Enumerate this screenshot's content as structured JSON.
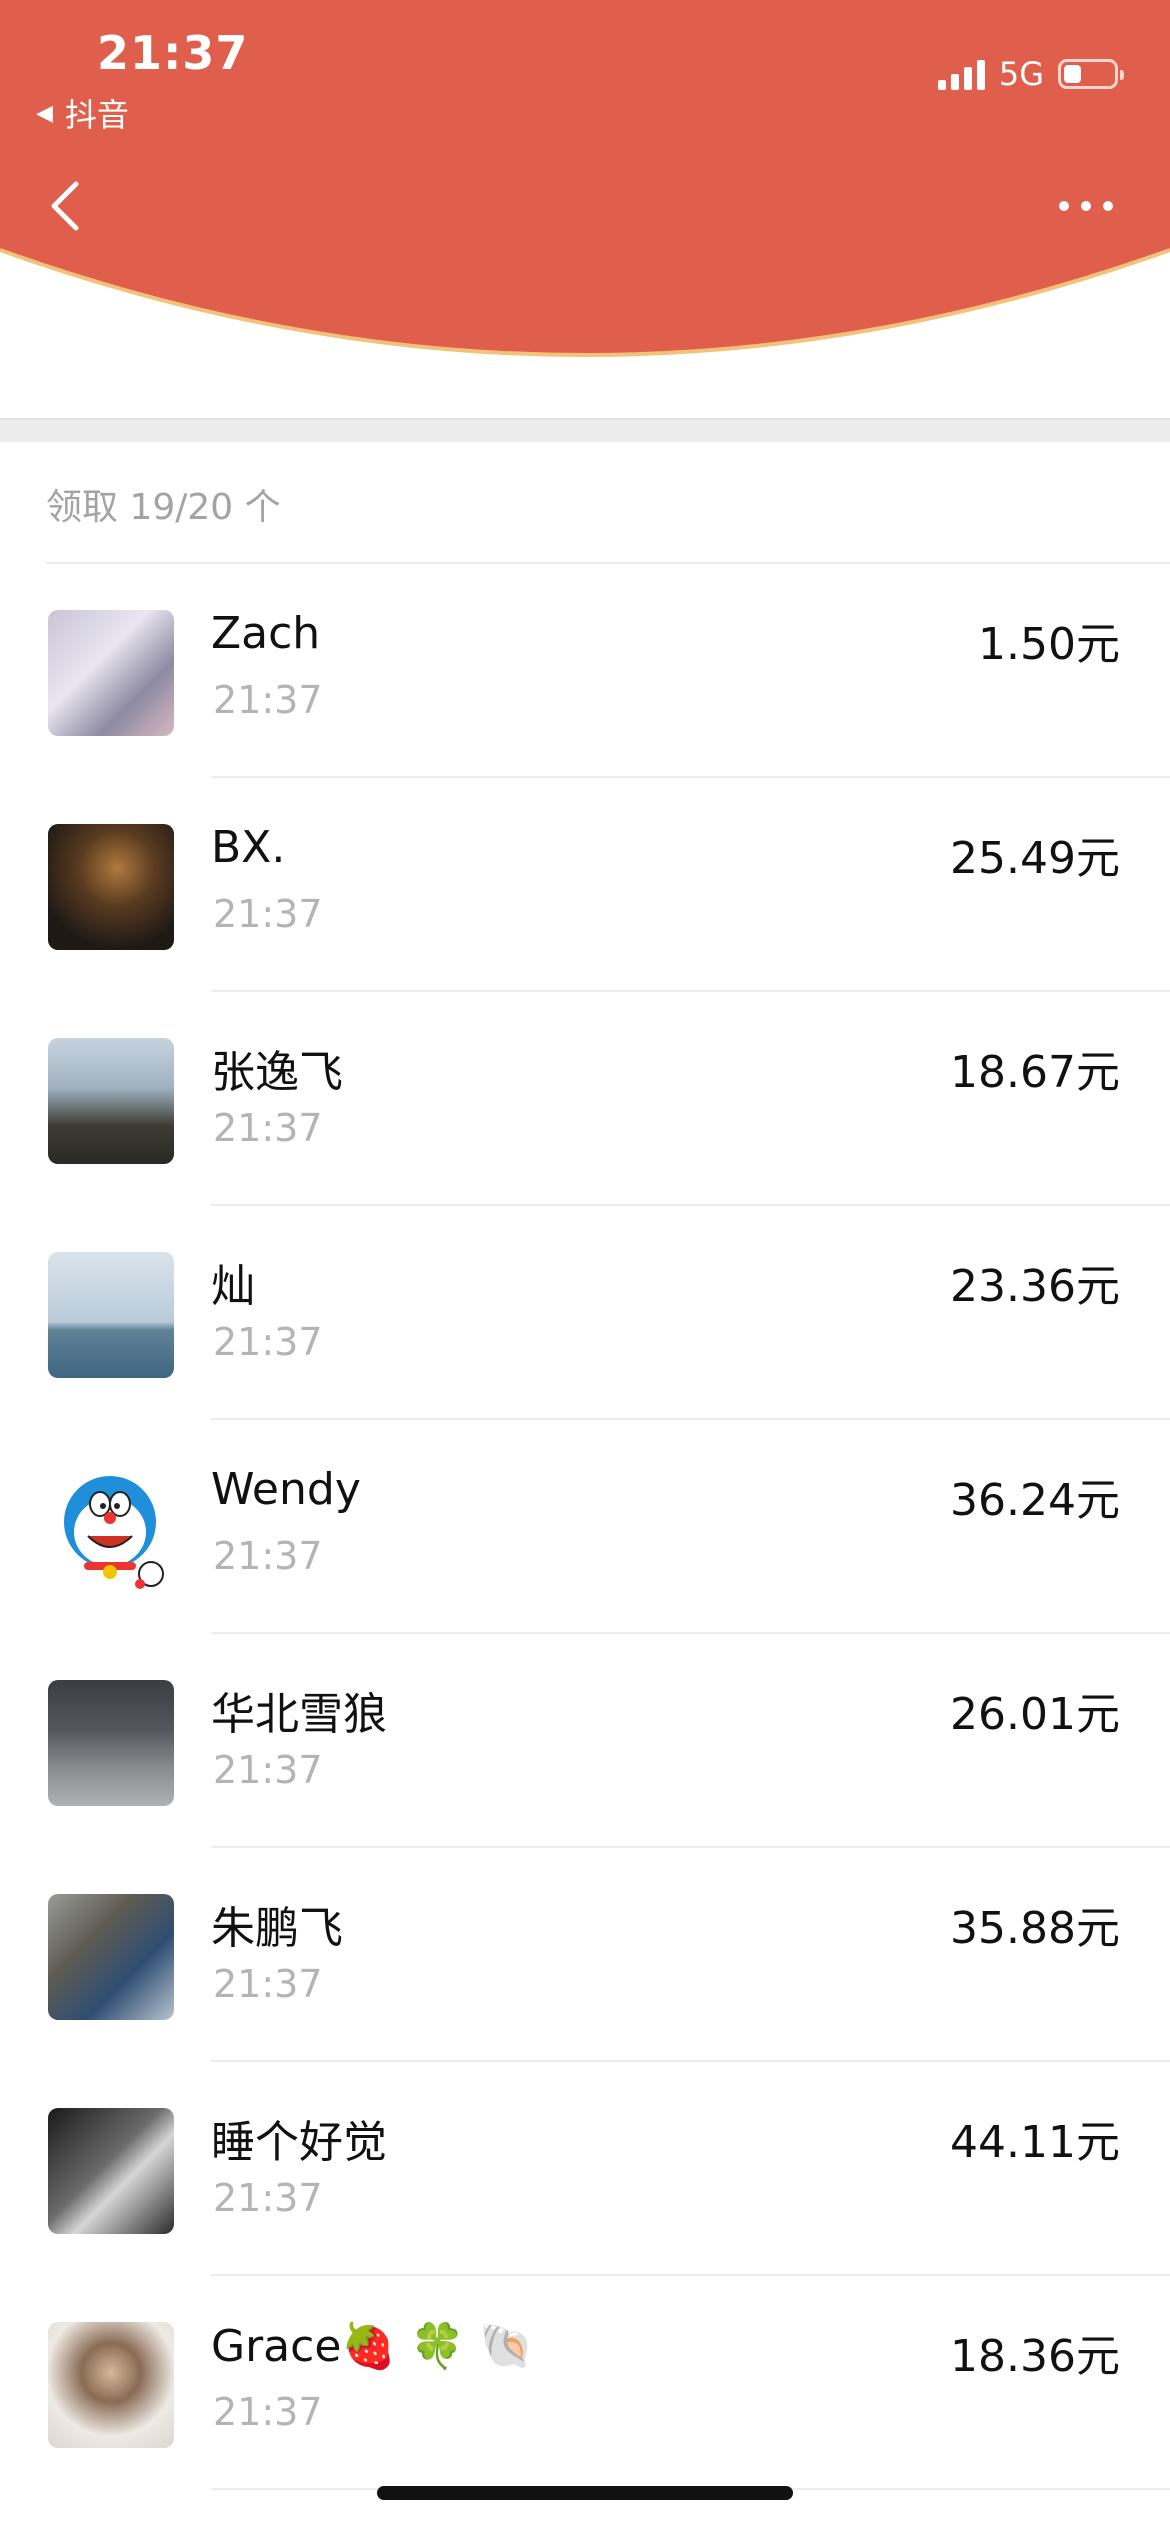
{
  "status_bar": {
    "time": "21:37",
    "back_app": "抖音",
    "network": "5G",
    "battery_level": 0.35
  },
  "nav": {
    "back_icon": "chevron-left-icon",
    "more_icon": "ellipsis-icon"
  },
  "colors": {
    "header_red": "#E05E4C",
    "header_edge": "#F3C27A"
  },
  "summary": "领取 19/20 个",
  "recipients": [
    {
      "name": "Zach",
      "time": "21:37",
      "amount": "1.50元"
    },
    {
      "name": "BX.",
      "time": "21:37",
      "amount": "25.49元"
    },
    {
      "name": "张逸飞",
      "time": "21:37",
      "amount": "18.67元"
    },
    {
      "name": "灿",
      "time": "21:37",
      "amount": "23.36元"
    },
    {
      "name": "Wendy",
      "time": "21:37",
      "amount": "36.24元"
    },
    {
      "name": "华北雪狼",
      "time": "21:37",
      "amount": "26.01元"
    },
    {
      "name": "朱鹏飞",
      "time": "21:37",
      "amount": "35.88元"
    },
    {
      "name": "睡个好觉",
      "time": "21:37",
      "amount": "44.11元"
    },
    {
      "name": "Grace🍓 🍀 🐚",
      "time": "21:37",
      "amount": "18.36元"
    }
  ]
}
